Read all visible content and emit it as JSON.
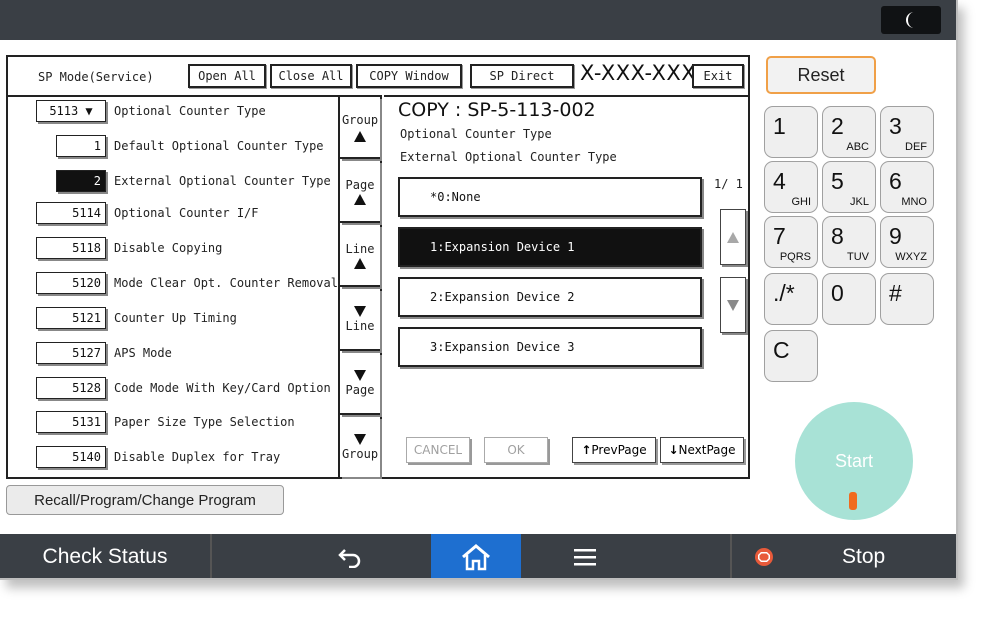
{
  "header": {
    "mode_label": "SP Mode(Service)",
    "open_all": "Open All",
    "close_all": "Close All",
    "copy_window": "COPY Window",
    "sp_direct": "SP Direct",
    "model": "X-XXX-XXX",
    "exit": "Exit"
  },
  "tree": [
    {
      "code": "5113 ▼",
      "label": "Optional Counter Type"
    },
    {
      "code": "1",
      "label": "Default Optional Counter Type"
    },
    {
      "code": "2",
      "label": "External Optional Counter Type"
    },
    {
      "code": "5114",
      "label": "Optional Counter I/F"
    },
    {
      "code": "5118",
      "label": "Disable Copying"
    },
    {
      "code": "5120",
      "label": "Mode Clear Opt. Counter Removal"
    },
    {
      "code": "5121",
      "label": "Counter Up Timing"
    },
    {
      "code": "5127",
      "label": "APS Mode"
    },
    {
      "code": "5128",
      "label": "Code Mode With Key/Card Option"
    },
    {
      "code": "5131",
      "label": "Paper Size Type Selection"
    },
    {
      "code": "5140",
      "label": "Disable Duplex for Tray"
    }
  ],
  "nav": {
    "group": "Group",
    "page": "Page",
    "line": "Line"
  },
  "detail": {
    "sp_code": "COPY : SP-5-113-002",
    "title1": "Optional Counter Type",
    "title2": "External Optional Counter Type",
    "page_count": "1/ 1",
    "options": [
      "*0:None",
      "1:Expansion Device 1",
      "2:Expansion Device 2",
      "3:Expansion Device 3"
    ],
    "cancel": "CANCEL",
    "ok": "OK",
    "prev_page": "PrevPage",
    "next_page": "NextPage"
  },
  "recall": "Recall/Program/Change Program",
  "reset": "Reset",
  "keypad": [
    {
      "main": "1",
      "sub": ""
    },
    {
      "main": "2",
      "sub": "ABC"
    },
    {
      "main": "3",
      "sub": "DEF"
    },
    {
      "main": "4",
      "sub": "GHI"
    },
    {
      "main": "5",
      "sub": "JKL"
    },
    {
      "main": "6",
      "sub": "MNO"
    },
    {
      "main": "7",
      "sub": "PQRS"
    },
    {
      "main": "8",
      "sub": "TUV"
    },
    {
      "main": "9",
      "sub": "WXYZ"
    },
    {
      "main": "./*",
      "sub": ""
    },
    {
      "main": "0",
      "sub": ""
    },
    {
      "main": "#",
      "sub": ""
    },
    {
      "main": "C",
      "sub": ""
    }
  ],
  "start": "Start",
  "bottom": {
    "check_status": "Check Status",
    "stop": "Stop"
  },
  "icons": {
    "moon": "moon-icon",
    "back": "back-arrow-icon",
    "home": "home-icon",
    "menu": "menu-icon",
    "stop": "stop-icon"
  },
  "colors": {
    "bar_bg": "#3a3f45",
    "home_active": "#1e6fd0",
    "reset_border": "#f0a048",
    "start_bg": "#a8e2d6",
    "start_led": "#f06b1e",
    "stop_icon": "#e85a3a"
  }
}
